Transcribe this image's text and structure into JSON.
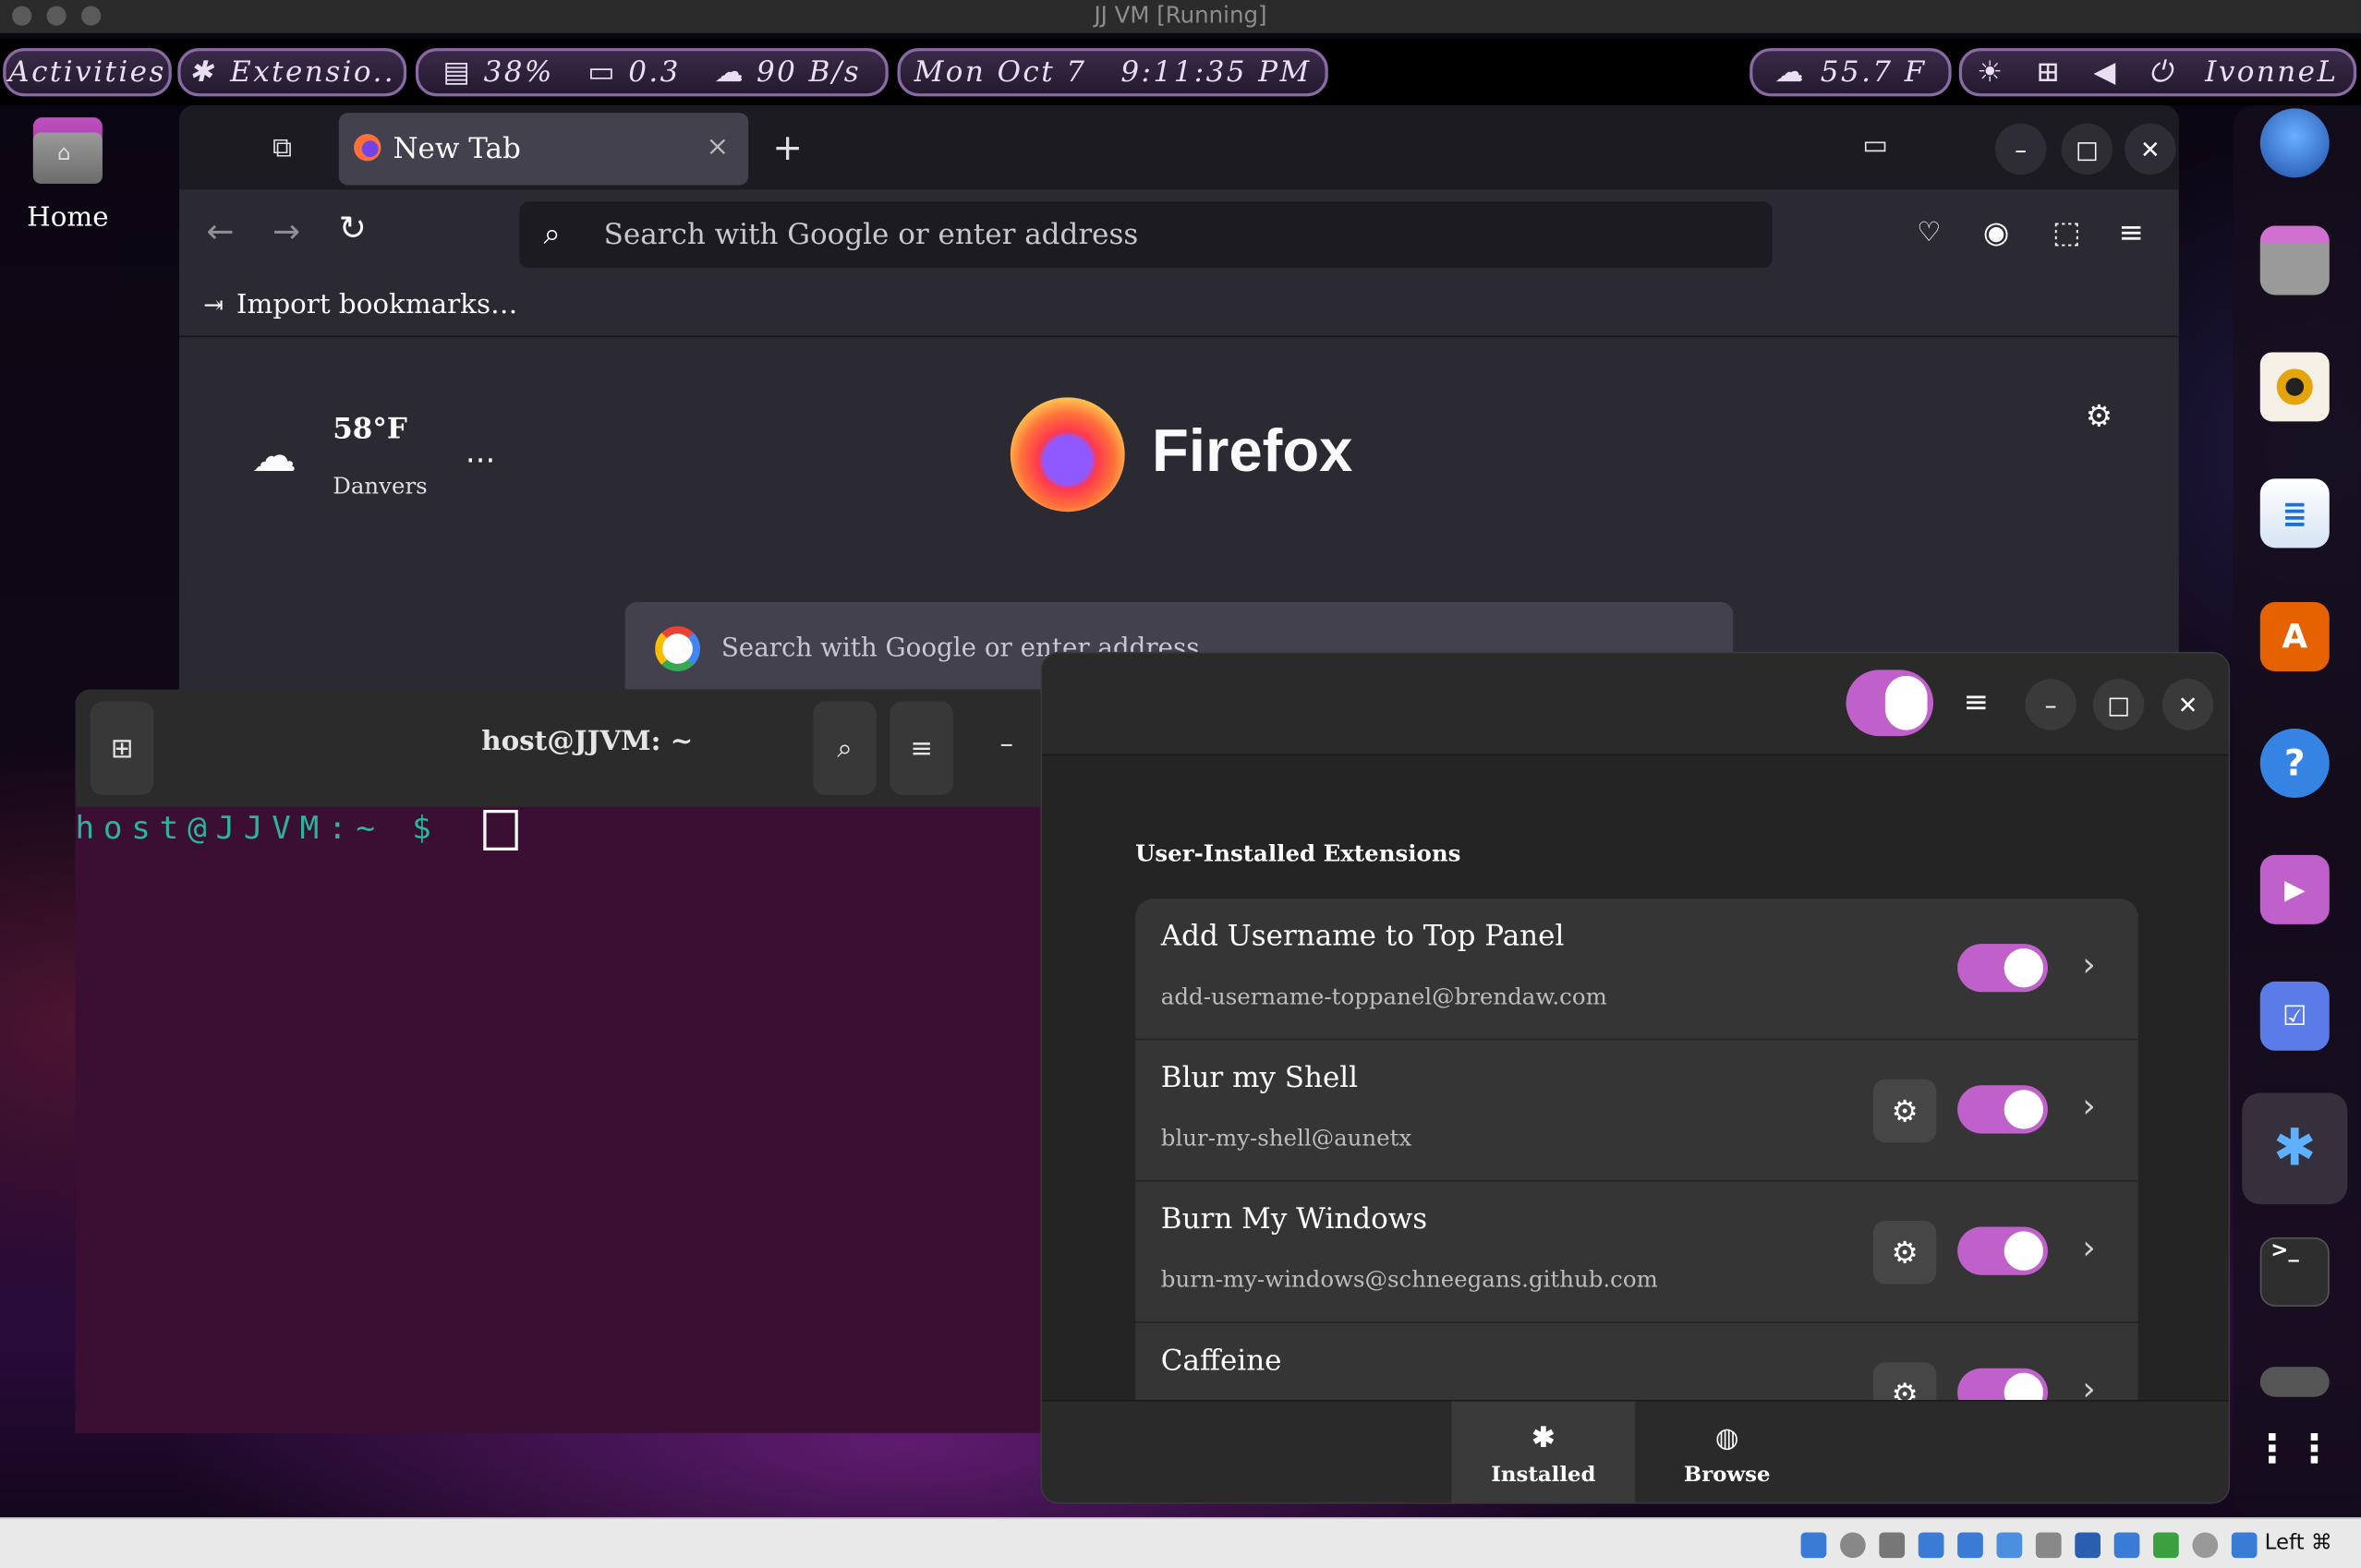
{
  "vm_window": {
    "title": "JJ VM [Running]"
  },
  "top_panel": {
    "activities": "Activities",
    "extensions": "Extensio..",
    "cpu": "38%",
    "load": "0.3",
    "net": "90 B/s",
    "clock": "Mon Oct 7   9:11:35 PM",
    "weather": "55.7 F",
    "username": "IvonneL"
  },
  "desktop": {
    "home_label": "Home"
  },
  "firefox": {
    "tab_title": "New Tab",
    "url_placeholder": "Search with Google or enter address",
    "import_bookmarks": "Import bookmarks…",
    "weather_temp": "58°F",
    "weather_city": "Danvers",
    "logo_text": "Firefox",
    "content_search_placeholder": "Search with Google or enter address"
  },
  "terminal": {
    "title": "host@JJVM: ~",
    "prompt": "host@JJVM:~ $"
  },
  "extensions_app": {
    "section_title": "User-Installed Extensions",
    "items": [
      {
        "name": "Add Username to Top Panel",
        "uuid": "add-username-toppanel@brendaw.com",
        "has_settings": false,
        "enabled": true
      },
      {
        "name": "Blur my Shell",
        "uuid": "blur-my-shell@aunetx",
        "has_settings": true,
        "enabled": true
      },
      {
        "name": "Burn My Windows",
        "uuid": "burn-my-windows@schneegans.github.com",
        "has_settings": true,
        "enabled": true
      },
      {
        "name": "Caffeine",
        "uuid": "",
        "has_settings": true,
        "enabled": true
      }
    ],
    "tabs": {
      "installed": "Installed",
      "browse": "Browse"
    }
  },
  "status_bar": {
    "host_key": "Left ⌘"
  },
  "colors": {
    "accent": "#c061cb",
    "terminal_bg": "#3b0f33",
    "prompt": "#2bb5a0"
  }
}
